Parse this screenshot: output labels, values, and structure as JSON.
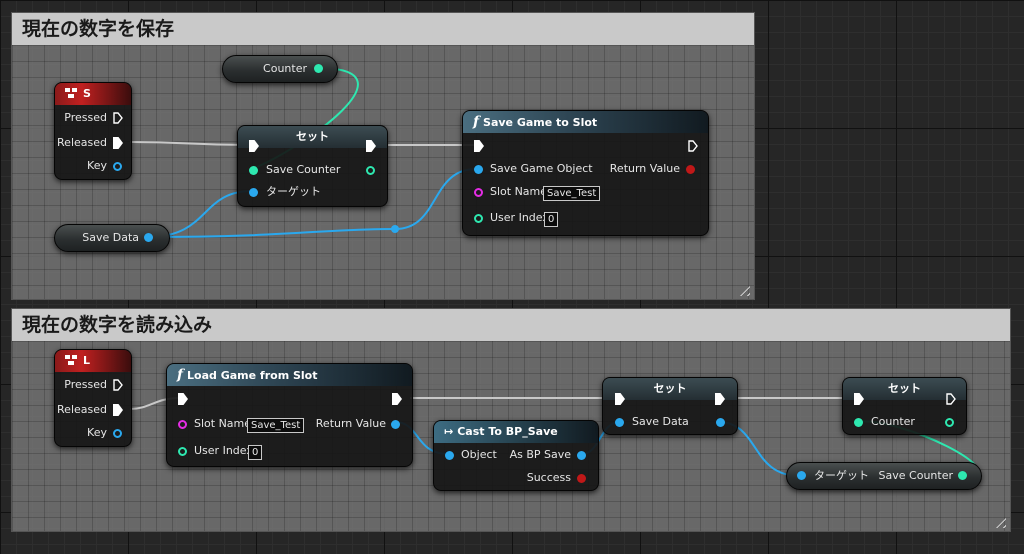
{
  "comments": {
    "save_title": "現在の数字を保存",
    "load_title": "現在の数字を読み込み"
  },
  "event_s": {
    "key": "S",
    "pressed": "Pressed",
    "released": "Released",
    "key_pin": "Key"
  },
  "event_l": {
    "key": "L",
    "pressed": "Pressed",
    "released": "Released",
    "key_pin": "Key"
  },
  "counter_getter": {
    "label": "Counter"
  },
  "save_data_getter": {
    "label": "Save Data"
  },
  "set_save_counter": {
    "title": "セット",
    "pin": "Save Counter",
    "target": "ターゲット"
  },
  "save_game_to_slot": {
    "title": "Save Game to Slot",
    "save_game_object": "Save Game Object",
    "return_value": "Return Value",
    "slot_name": "Slot Name",
    "slot_name_value": "Save_Test",
    "user_index": "User Index",
    "user_index_value": "0"
  },
  "load_game_from_slot": {
    "title": "Load Game from Slot",
    "slot_name": "Slot Name",
    "slot_name_value": "Save_Test",
    "return_value": "Return Value",
    "user_index": "User Index",
    "user_index_value": "0"
  },
  "cast": {
    "title": "Cast To BP_Save",
    "object": "Object",
    "as_bp_save": "As BP Save",
    "success": "Success"
  },
  "set_save_data": {
    "title": "セット",
    "pin": "Save Data"
  },
  "set_counter": {
    "title": "セット",
    "pin": "Counter"
  },
  "save_counter_getter": {
    "target": "ターゲット",
    "output": "Save Counter"
  },
  "colors": {
    "exec": "#ffffff",
    "object": "#2aa8ee",
    "int": "#2ee8b0",
    "string": "#e52ce5",
    "bool": "#c01818"
  },
  "icons": {
    "event": "keyboard-event-icon",
    "function": "function-icon",
    "cast": "cast-icon"
  }
}
